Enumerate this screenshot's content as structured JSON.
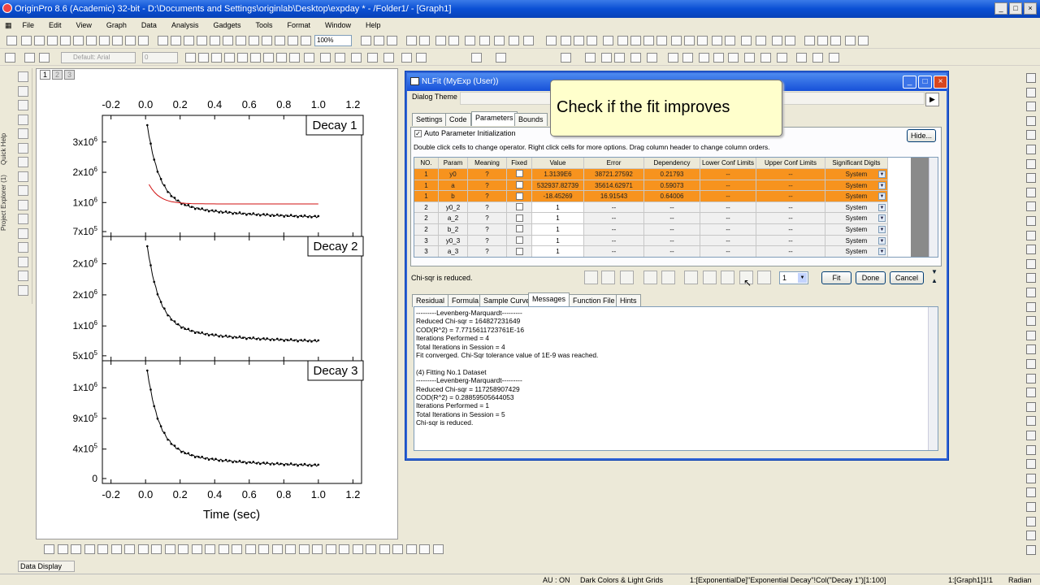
{
  "app_title": "OriginPro 8.6 (Academic) 32-bit - D:\\Documents and Settings\\originlab\\Desktop\\expday * - /Folder1/ - [Graph1]",
  "menu": [
    "File",
    "Edit",
    "View",
    "Graph",
    "Data",
    "Analysis",
    "Gadgets",
    "Tools",
    "Format",
    "Window",
    "Help"
  ],
  "toolbar": {
    "zoom": "100%",
    "font": "Default: Arial",
    "fontsize": "0"
  },
  "side_strip": {
    "project_explorer": "Project Explorer (1)",
    "quick_help": "Quick Help"
  },
  "graph": {
    "layers": [
      "1",
      "2",
      "3"
    ],
    "x_ticks": [
      "-0.2",
      "0.0",
      "0.2",
      "0.4",
      "0.6",
      "0.8",
      "1.0",
      "1.2"
    ],
    "xlabel": "Time (sec)",
    "panels": [
      {
        "label": "Decay 1",
        "yticks": [
          "3x10",
          "2x10",
          "1x10",
          "7x10"
        ],
        "yexp": [
          "6",
          "6",
          "6",
          "5"
        ]
      },
      {
        "label": "Decay 2",
        "yticks": [
          "2x10",
          "2x10",
          "1x10",
          "5x10"
        ],
        "yexp": [
          "6",
          "6",
          "6",
          "5"
        ]
      },
      {
        "label": "Decay 3",
        "yticks": [
          "1x10",
          "9x10",
          "4x10",
          "0"
        ],
        "yexp": [
          "6",
          "5",
          "5",
          ""
        ]
      }
    ]
  },
  "dialog": {
    "title": "NLFit (MyExp (User))",
    "theme_label": "Dialog Theme",
    "tabs": [
      "Settings",
      "Code",
      "Parameters",
      "Bounds"
    ],
    "active_tab": "Parameters",
    "auto_init": "Auto Parameter Initialization",
    "hide_button": "Hide...",
    "hint": "Double click cells to change operator. Right click cells for more options. Drag column header to change column orders.",
    "columns": [
      "NO.",
      "Param",
      "Meaning",
      "Fixed",
      "Value",
      "Error",
      "Dependency",
      "Lower Conf Limits",
      "Upper Conf Limits",
      "Significant Digits"
    ],
    "rows": [
      {
        "no": "1",
        "param": "y0",
        "meaning": "?",
        "value": "1.3139E6",
        "error": "38721.27592",
        "dep": "0.21793",
        "lcl": "--",
        "ucl": "--",
        "sig": "System",
        "hl": true
      },
      {
        "no": "1",
        "param": "a",
        "meaning": "?",
        "value": "532937.82739",
        "error": "35614.62971",
        "dep": "0.59073",
        "lcl": "--",
        "ucl": "--",
        "sig": "System",
        "hl": true
      },
      {
        "no": "1",
        "param": "b",
        "meaning": "?",
        "value": "-18.45269",
        "error": "16.91543",
        "dep": "0.64006",
        "lcl": "--",
        "ucl": "--",
        "sig": "System",
        "hl": true
      },
      {
        "no": "2",
        "param": "y0_2",
        "meaning": "?",
        "value": "1",
        "error": "--",
        "dep": "--",
        "lcl": "--",
        "ucl": "--",
        "sig": "System",
        "hl": false
      },
      {
        "no": "2",
        "param": "a_2",
        "meaning": "?",
        "value": "1",
        "error": "--",
        "dep": "--",
        "lcl": "--",
        "ucl": "--",
        "sig": "System",
        "hl": false
      },
      {
        "no": "2",
        "param": "b_2",
        "meaning": "?",
        "value": "1",
        "error": "--",
        "dep": "--",
        "lcl": "--",
        "ucl": "--",
        "sig": "System",
        "hl": false
      },
      {
        "no": "3",
        "param": "y0_3",
        "meaning": "?",
        "value": "1",
        "error": "--",
        "dep": "--",
        "lcl": "--",
        "ucl": "--",
        "sig": "System",
        "hl": false
      },
      {
        "no": "3",
        "param": "a_3",
        "meaning": "?",
        "value": "1",
        "error": "--",
        "dep": "--",
        "lcl": "--",
        "ucl": "--",
        "sig": "System",
        "hl": false
      }
    ],
    "status": "Chi-sqr is reduced.",
    "iter_value": "1",
    "buttons": {
      "fit": "Fit",
      "done": "Done",
      "cancel": "Cancel"
    },
    "bottom_tabs": [
      "Residual",
      "Formula",
      "Sample Curve",
      "Messages",
      "Function File",
      "Hints"
    ],
    "active_bottom_tab": "Messages",
    "messages": "---------Levenberg-Marquardt---------\nReduced Chi-sqr = 164827231649\nCOD(R^2) = 7.7715611723761E-16\nIterations Performed = 4\nTotal Iterations in Session = 4\nFit converged. Chi-Sqr tolerance value of 1E-9 was reached.\n\n(4) Fitting No.1 Dataset\n---------Levenberg-Marquardt---------\nReduced Chi-sqr = 117258907429\nCOD(R^2) = 0.28859505644053\nIterations Performed = 1\nTotal Iterations in Session = 5\nChi-sqr is reduced."
  },
  "callout": "Check if the fit improves",
  "data_display": "Data Display",
  "statusbar": {
    "au": "AU : ON",
    "theme": "Dark Colors & Light Grids",
    "info": "1:[ExponentialDe]\"Exponential Decay\"!Col(\"Decay 1\")[1:100]",
    "graph": "1:[Graph1]1!1",
    "units": "Radian"
  }
}
